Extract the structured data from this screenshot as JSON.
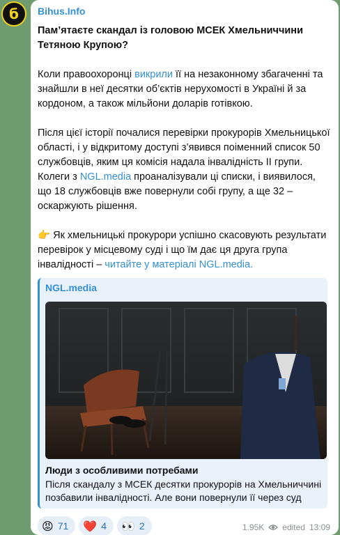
{
  "channel": {
    "name": "Bihus.Info",
    "avatar_glyph": "б"
  },
  "post": {
    "title": "Пам’ятаєте скандал із головою МСЕК Хмельниччини Тетяною Крупою?",
    "p1_before": "Коли правоохоронці ",
    "p1_link": "викрили",
    "p1_after": " її на незаконному збагаченні та знайшли в неї десятки об’єктів нерухомості в Україні й за кордоном, а також мільйони доларів готівкою.",
    "p2_part1": "Після цієї історії почалися перевірки прокурорів Хмельницької області, і у відкритому доступі з’явився поіменний список 50 службовців, яким ця комісія надала інвалідність II групи. Колеги з ",
    "p2_link": "NGL.media",
    "p2_part2": " проаналізували ці списки, і виявилося, що 18 службовців вже повернули собі групу, а ще 32 – оскаржують рішення.",
    "p3_emoji": "👉",
    "p3_text": " Як хмельницькі прокурори успішно скасовують результати перевірок у місцевому суді і що їм дає ця друга група інвалідності – ",
    "p3_link": "читайте у матеріалі NGL.media."
  },
  "preview": {
    "site": "NGL.media",
    "title": "Люди з особливими потребами",
    "description": "Після скандалу з МСЕК десятки прокурорів на Хмельниччині позбавили інвалідності. Але вони повернули її через суд"
  },
  "reactions": [
    {
      "emoji": "😡",
      "count": "71"
    },
    {
      "emoji": "❤️",
      "count": "4"
    },
    {
      "emoji": "👀",
      "count": "2"
    }
  ],
  "meta": {
    "views": "1.95K",
    "edited": "edited",
    "time": "13:09"
  },
  "colors": {
    "accent": "#3390d6",
    "background": "#6f9c6e",
    "avatar_ring": "#f2d21b"
  }
}
